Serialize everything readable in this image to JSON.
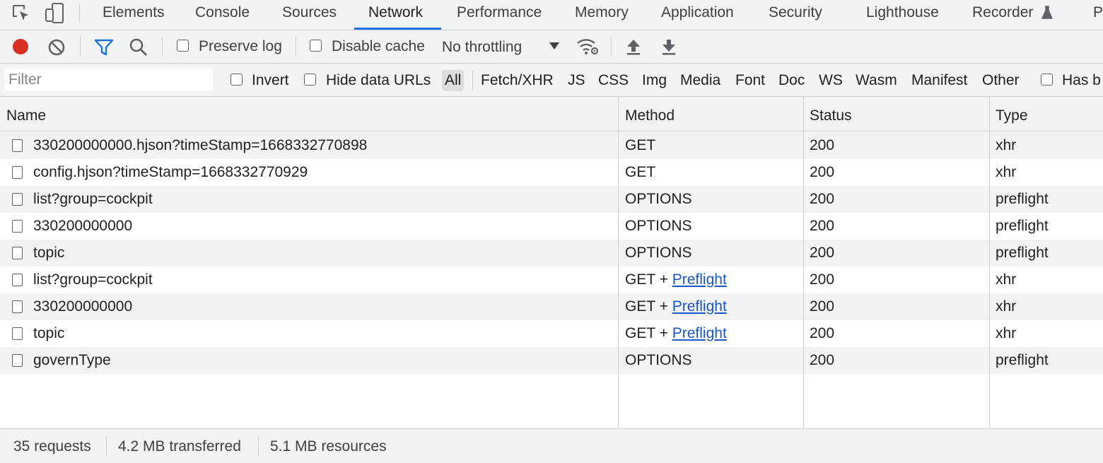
{
  "tabs": [
    "Elements",
    "Console",
    "Sources",
    "Network",
    "Performance",
    "Memory",
    "Application",
    "Security",
    "Lighthouse",
    "Recorder",
    "P"
  ],
  "active_tab": "Network",
  "toolbar": {
    "preserve_log": "Preserve log",
    "disable_cache": "Disable cache",
    "throttling": "No throttling",
    "preserve_log_checked": false,
    "disable_cache_checked": false
  },
  "filterbar": {
    "filter_placeholder": "Filter",
    "invert": "Invert",
    "hide_data_urls": "Hide data URLs",
    "types": [
      "All",
      "Fetch/XHR",
      "JS",
      "CSS",
      "Img",
      "Media",
      "Font",
      "Doc",
      "WS",
      "Wasm",
      "Manifest",
      "Other"
    ],
    "active_type": "All",
    "has_blocked": "Has b"
  },
  "table": {
    "headers": {
      "name": "Name",
      "method": "Method",
      "status": "Status",
      "type": "Type"
    },
    "rows": [
      {
        "name": "330200000000.hjson?timeStamp=1668332770898",
        "method": "GET",
        "preflight": "",
        "status": "200",
        "type": "xhr"
      },
      {
        "name": "config.hjson?timeStamp=1668332770929",
        "method": "GET",
        "preflight": "",
        "status": "200",
        "type": "xhr"
      },
      {
        "name": "list?group=cockpit",
        "method": "OPTIONS",
        "preflight": "",
        "status": "200",
        "type": "preflight"
      },
      {
        "name": "330200000000",
        "method": "OPTIONS",
        "preflight": "",
        "status": "200",
        "type": "preflight"
      },
      {
        "name": "topic",
        "method": "OPTIONS",
        "preflight": "",
        "status": "200",
        "type": "preflight"
      },
      {
        "name": "list?group=cockpit",
        "method": "GET + ",
        "preflight": "Preflight",
        "status": "200",
        "type": "xhr"
      },
      {
        "name": "330200000000",
        "method": "GET + ",
        "preflight": "Preflight",
        "status": "200",
        "type": "xhr"
      },
      {
        "name": "topic",
        "method": "GET + ",
        "preflight": "Preflight",
        "status": "200",
        "type": "xhr"
      },
      {
        "name": "governType",
        "method": "OPTIONS",
        "preflight": "",
        "status": "200",
        "type": "preflight"
      }
    ]
  },
  "statusbar": {
    "requests": "35 requests",
    "transferred": "4.2 MB transferred",
    "resources": "5.1 MB resources"
  },
  "colors": {
    "accent": "#1a73e8",
    "record": "#d93025",
    "link": "#1a55c9"
  }
}
